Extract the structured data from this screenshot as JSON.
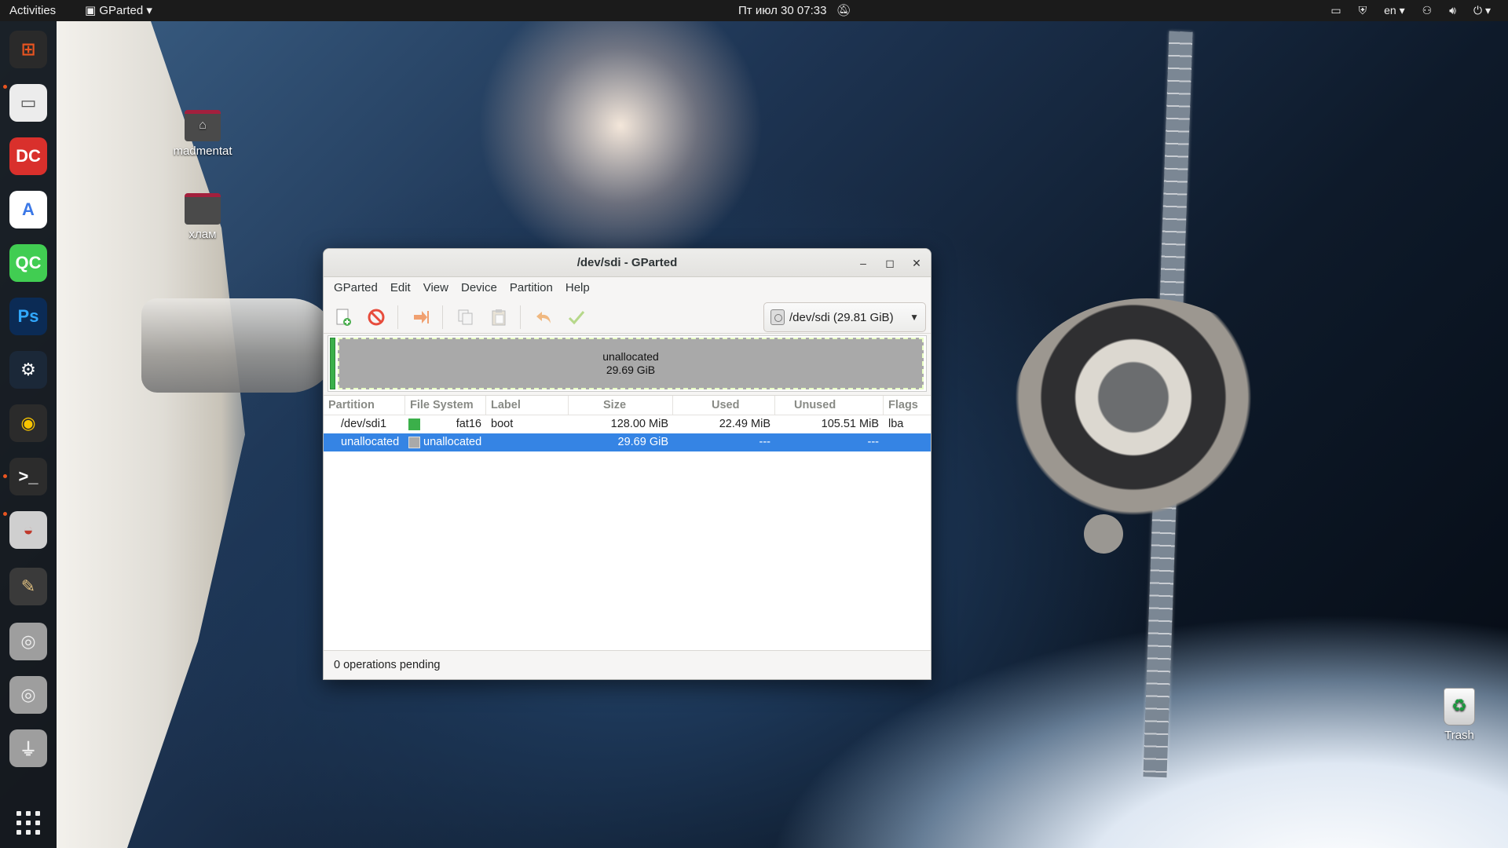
{
  "topbar": {
    "activities": "Activities",
    "app_menu": "GParted",
    "clock": "Пт июл 30  07:33",
    "lang": "en"
  },
  "dock": {
    "items": [
      {
        "name": "flathub-store-icon",
        "glyph": "⊞",
        "bg": "#2a2a2a",
        "fg": "#e95420"
      },
      {
        "name": "files-icon",
        "glyph": "▭",
        "bg": "#ececec",
        "fg": "#555"
      },
      {
        "name": "doublecmd-icon",
        "glyph": "DC",
        "bg": "#d9302c",
        "fg": "#fff"
      },
      {
        "name": "android-studio-icon",
        "glyph": "A",
        "bg": "#ffffff",
        "fg": "#3b78e7"
      },
      {
        "name": "qt-creator-icon",
        "glyph": "QC",
        "bg": "#41cd52",
        "fg": "#fff"
      },
      {
        "name": "photoshop-icon",
        "glyph": "Ps",
        "bg": "#0b2b55",
        "fg": "#31a8ff"
      },
      {
        "name": "steam-icon",
        "glyph": "⚙",
        "bg": "#1b2838",
        "fg": "#fff"
      },
      {
        "name": "rhythmbox-icon",
        "glyph": "◉",
        "bg": "#2b2b2b",
        "fg": "#f7c400"
      },
      {
        "name": "terminal-icon",
        "glyph": ">_",
        "bg": "#2c2c2c",
        "fg": "#fff"
      },
      {
        "name": "gparted-icon",
        "glyph": "◒",
        "bg": "#cfcfcf",
        "fg": "#c0392b"
      },
      {
        "name": "gimp-icon",
        "glyph": "✎",
        "bg": "#3a3a3a",
        "fg": "#e0c080"
      },
      {
        "name": "disc-drive-icon",
        "glyph": "◎",
        "bg": "#9e9e9e",
        "fg": "#eee"
      },
      {
        "name": "disc-drive-2-icon",
        "glyph": "◎",
        "bg": "#9e9e9e",
        "fg": "#eee"
      },
      {
        "name": "usb-drive-icon",
        "glyph": "⏚",
        "bg": "#9e9e9e",
        "fg": "#eee"
      }
    ]
  },
  "desktop": {
    "icons": [
      {
        "label": "madmentat"
      },
      {
        "label": "хлам"
      },
      {
        "label": "Trash"
      }
    ]
  },
  "window": {
    "title": "/dev/sdi - GParted",
    "menu": [
      "GParted",
      "Edit",
      "View",
      "Device",
      "Partition",
      "Help"
    ],
    "device": "/dev/sdi  (29.81 GiB)",
    "diskmap": {
      "label": "unallocated",
      "size": "29.69 GiB"
    },
    "columns": [
      "Partition",
      "File System",
      "Label",
      "Size",
      "Used",
      "Unused",
      "Flags"
    ],
    "rows": [
      {
        "partition": "/dev/sdi1",
        "fs": "fat16",
        "fs_color": "#3bb04a",
        "label": "boot",
        "size": "128.00 MiB",
        "used": "22.49 MiB",
        "unused": "105.51 MiB",
        "flags": "lba",
        "selected": false
      },
      {
        "partition": "unallocated",
        "fs": "unallocated",
        "fs_color": "#a9a9a9",
        "label": "",
        "size": "29.69 GiB",
        "used": "---",
        "unused": "---",
        "flags": "",
        "selected": true
      }
    ],
    "status": "0 operations pending"
  }
}
